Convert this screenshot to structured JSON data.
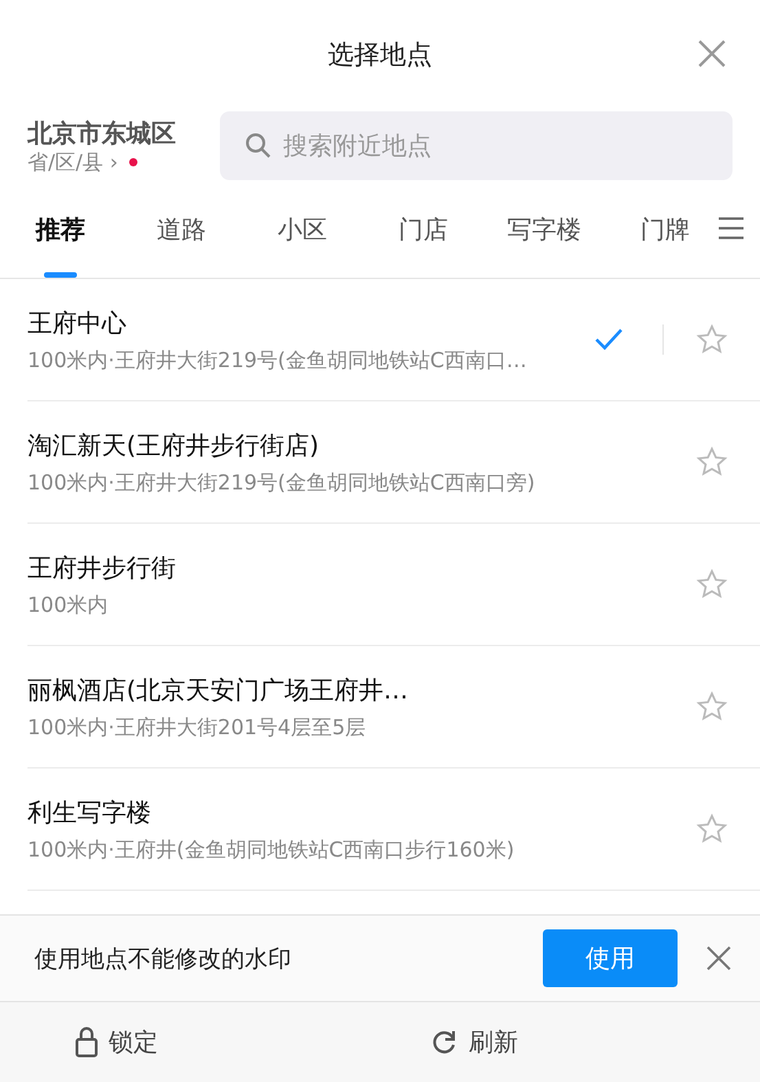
{
  "title": "选择地点",
  "region": {
    "city": "北京市东城区",
    "picker": "省/区/县 ›",
    "notice_dot": true
  },
  "search": {
    "placeholder": "搜索附近地点"
  },
  "tabs": [
    {
      "label": "推荐",
      "selected": true
    },
    {
      "label": "道路",
      "selected": false
    },
    {
      "label": "小区",
      "selected": false
    },
    {
      "label": "门店",
      "selected": false
    },
    {
      "label": "写字楼",
      "selected": false
    },
    {
      "label": "门牌",
      "selected": false
    }
  ],
  "places": [
    {
      "name": "王府中心",
      "detail": "100米内·王府井大街219号(金鱼胡同地铁站C西南口…",
      "selected": true,
      "starred": false
    },
    {
      "name": "淘汇新天(王府井步行街店)",
      "detail": "100米内·王府井大街219号(金鱼胡同地铁站C西南口旁)",
      "selected": false,
      "starred": false
    },
    {
      "name": "王府井步行街",
      "detail": "100米内",
      "selected": false,
      "starred": false
    },
    {
      "name": "丽枫酒店(北京天安门广场王府井…",
      "detail": "100米内·王府井大街201号4层至5层",
      "selected": false,
      "starred": false
    },
    {
      "name": "利生写字楼",
      "detail": "100米内·王府井(金鱼胡同地铁站C西南口步行160米)",
      "selected": false,
      "starred": false
    }
  ],
  "watermark_bar": {
    "text": "使用地点不能修改的水印",
    "button": "使用"
  },
  "footer": [
    {
      "kind": "lock",
      "label": "锁定"
    },
    {
      "kind": "refresh",
      "label": "刷新"
    }
  ]
}
